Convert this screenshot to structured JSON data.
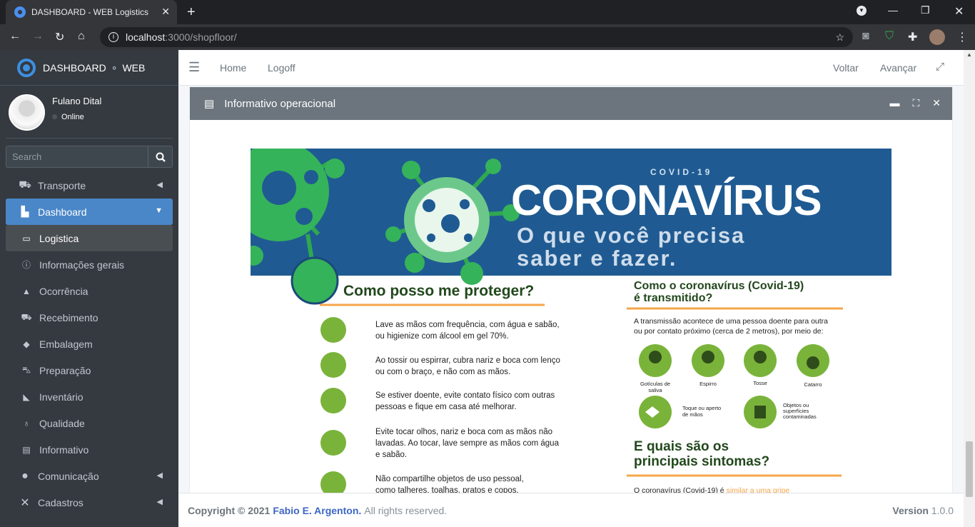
{
  "browser": {
    "tab_title": "DASHBOARD - WEB Logistics",
    "url_host": "localhost",
    "url_path": ":3000/shopfloor/"
  },
  "brand": {
    "part1": "DASHBOARD",
    "sep": "∘",
    "part2": "WEB"
  },
  "user": {
    "name": "Fulano Dital",
    "status": "Online"
  },
  "search": {
    "placeholder": "Search"
  },
  "nav": [
    {
      "label": "Transporte",
      "icon": "truck-icon"
    },
    {
      "label": "Dashboard",
      "icon": "chart-icon"
    },
    {
      "label": "Logistica",
      "icon": "monitor-icon"
    },
    {
      "label": "Informações gerais",
      "icon": "info-icon"
    },
    {
      "label": "Ocorrência",
      "icon": "warning-icon"
    },
    {
      "label": "Recebimento",
      "icon": "truck-icon"
    },
    {
      "label": "Embalagem",
      "icon": "box-icon"
    },
    {
      "label": "Preparação",
      "icon": "cart-icon"
    },
    {
      "label": "Inventário",
      "icon": "area-chart-icon"
    },
    {
      "label": "Qualidade",
      "icon": "award-icon"
    },
    {
      "label": "Informativo",
      "icon": "presentation-icon"
    },
    {
      "label": "Comunicação",
      "icon": "chat-icon"
    },
    {
      "label": "Cadastros",
      "icon": "tools-icon"
    }
  ],
  "topnav": {
    "home": "Home",
    "logoff": "Logoff",
    "back": "Voltar",
    "forward": "Avançar"
  },
  "card": {
    "title": "Informativo operacional"
  },
  "poster": {
    "kicker": "COVID-19",
    "title": "CORONAVÍRUS",
    "subtitle1": "O que você precisa",
    "subtitle2": "saber e fazer.",
    "left_heading": "Como posso me proteger?",
    "tips": [
      [
        "Lave as mãos com frequência, com água e sabão,",
        "ou higienize com álcool em gel 70%."
      ],
      [
        "Ao tossir ou espirrar, cubra nariz e boca com lenço",
        "ou com o braço, e não com as mãos."
      ],
      [
        "Se estiver doente, evite contato físico com outras",
        "pessoas e fique em casa até melhorar."
      ],
      [
        "Evite tocar olhos, nariz e boca com as mãos não",
        "lavadas. Ao tocar, lave sempre as mãos com água",
        "e sabão."
      ],
      [
        "Não compartilhe objetos de uso pessoal,",
        "como talheres, toalhas, pratos e copos."
      ]
    ],
    "right_heading1": "Como o coronavírus  (Covid-19)",
    "right_heading2": "é transmitido?",
    "transmission1": "A transmissão acontece de uma pessoa doente para outra",
    "transmission2": "ou por contato próximo (cerca de 2 metros), por meio de:",
    "icons": [
      "Gotículas de saliva",
      "Espirro",
      "Tosse",
      "Catarro"
    ],
    "icon_touch1": "Toque ou aperto",
    "icon_touch2": "de mãos",
    "icon_obj1": "Objetos ou",
    "icon_obj2": "superfícies",
    "icon_obj3": "contaminadas",
    "symptoms1": "E quais são os",
    "symptoms2": "principais sintomas?",
    "symptoms_text": "O coronavírus (Covid-19) é",
    "symptoms_link": "similar a uma gripe"
  },
  "footer": {
    "copyright": "Copyright © 2021",
    "author": "Fabio E. Argenton.",
    "rights": "All rights reserved.",
    "version_label": "Version",
    "version": "1.0.0"
  }
}
